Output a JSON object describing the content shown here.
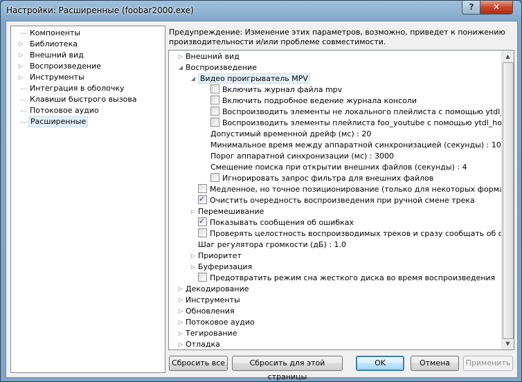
{
  "window": {
    "title": "Настройки: Расширенные (foobar2000.exe)",
    "help_glyph": "?",
    "close_glyph": "✕"
  },
  "left_tree": [
    {
      "label": "Компоненты",
      "expandable": false
    },
    {
      "label": "Библиотека",
      "expandable": true
    },
    {
      "label": "Внешний вид",
      "expandable": true
    },
    {
      "label": "Воспроизведение",
      "expandable": true
    },
    {
      "label": "Инструменты",
      "expandable": true
    },
    {
      "label": "Интеграция в оболочку",
      "expandable": false
    },
    {
      "label": "Клавиши быстрого вызова",
      "expandable": false
    },
    {
      "label": "Потоковое аудио",
      "expandable": false
    },
    {
      "label": "Расширенные",
      "expandable": false,
      "selected": true
    }
  ],
  "warning": "Предупреждение: Изменение этих параметров, возможно, приведет к понижению производительности и/или проблеме совместимости.",
  "right_tree": [
    {
      "label": "Внешний вид",
      "level": 0,
      "exp": "▷"
    },
    {
      "label": "Воспроизведение",
      "level": 0,
      "exp": "◢"
    },
    {
      "label": "Видео проигрыватель MPV",
      "level": 1,
      "exp": "◢",
      "highlight": true
    },
    {
      "label": "Включить журнал файла mpv",
      "level": 2,
      "cb": "unchecked"
    },
    {
      "label": "Включить подробное ведение журнала консоли",
      "level": 2,
      "cb": "unchecked"
    },
    {
      "label": "Воспроизводить элементы не локального плейлиста с помощью ytdl_hook",
      "level": 2,
      "cb": "unchecked"
    },
    {
      "label": "Воспроизводить элементы плейлиста foo_youtube с помощью ytdl_hook",
      "level": 2,
      "cb": "unchecked"
    },
    {
      "label": "Допустимый временной дрейф (мс) : 20",
      "level": 2
    },
    {
      "label": "Минимальное время между аппаратной синхронизацией (секунды) : 10",
      "level": 2
    },
    {
      "label": "Порог аппаратной синхронизации (мс) : 3000",
      "level": 2
    },
    {
      "label": "Смещение поиска при открытии внешних файлов (секунды) : 4",
      "level": 2
    },
    {
      "label": "Игнорировать запрос фильтра для внешних файлов",
      "level": 2,
      "cb": "unchecked"
    },
    {
      "label": "Медленное, но точное позиционирование (только для некоторых форматов)",
      "level": 1,
      "cb": "unchecked"
    },
    {
      "label": "Очистить очередность воспроизведения при ручной смене трека",
      "level": 1,
      "cb": "checked"
    },
    {
      "label": "Перемешивание",
      "level": 1,
      "exp": "▷"
    },
    {
      "label": "Показывать сообщения об ошибках",
      "level": 1,
      "cb": "checked"
    },
    {
      "label": "Проверять целостность воспроизводимых треков и сразу сообщать об ошибках",
      "level": 1,
      "cb": "unchecked"
    },
    {
      "label": "Шаг регулятора громкости (дБ) : 1.0",
      "level": 1
    },
    {
      "label": "Приоритет",
      "level": 1,
      "exp": "▷"
    },
    {
      "label": "Буферизация",
      "level": 1,
      "exp": "▷"
    },
    {
      "label": "Предотвратить режим сна жесткого диска во время воспроизведения",
      "level": 1,
      "cb": "unchecked"
    },
    {
      "label": "Декодирование",
      "level": 0,
      "exp": "▷"
    },
    {
      "label": "Инструменты",
      "level": 0,
      "exp": "▷"
    },
    {
      "label": "Обновления",
      "level": 0,
      "exp": "▷"
    },
    {
      "label": "Потоковое аудио",
      "level": 0,
      "exp": "▷"
    },
    {
      "label": "Тегирование",
      "level": 0,
      "exp": "▷"
    },
    {
      "label": "Отладка",
      "level": 0,
      "exp": "▷"
    }
  ],
  "buttons": {
    "reset_all": "Сбросить все",
    "reset_page": "Сбросить для этой страницы",
    "ok": "OK",
    "cancel": "Отмена",
    "apply": "Применить"
  },
  "icons": {
    "scroll_up": "▲",
    "scroll_down": "▼"
  }
}
